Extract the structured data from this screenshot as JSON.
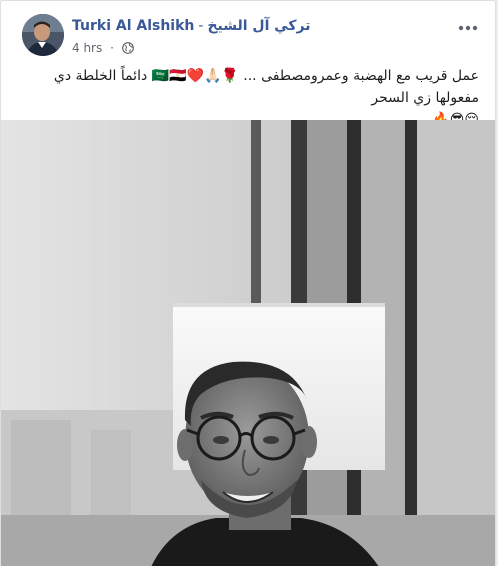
{
  "post": {
    "author_en": "Turki Al Alshikh",
    "name_separator": "-",
    "author_ar": "تركي آل الشيخ",
    "timestamp": "4 hrs",
    "meta_separator": "·",
    "privacy_icon": "globe-icon",
    "more_icon": "more-options-icon",
    "text_line_1": "عمل قريب مع الهضبة وعمرومصطفى ... 🌹🙏🏻❤️🇸🇦🇪🇬 دائماً الخلطة دي مفعولها زي السحر",
    "text_line_2": "😌😎🔥"
  },
  "colors": {
    "author_link": "#385898",
    "meta_text": "#606770",
    "body_text": "#1c1e21"
  }
}
